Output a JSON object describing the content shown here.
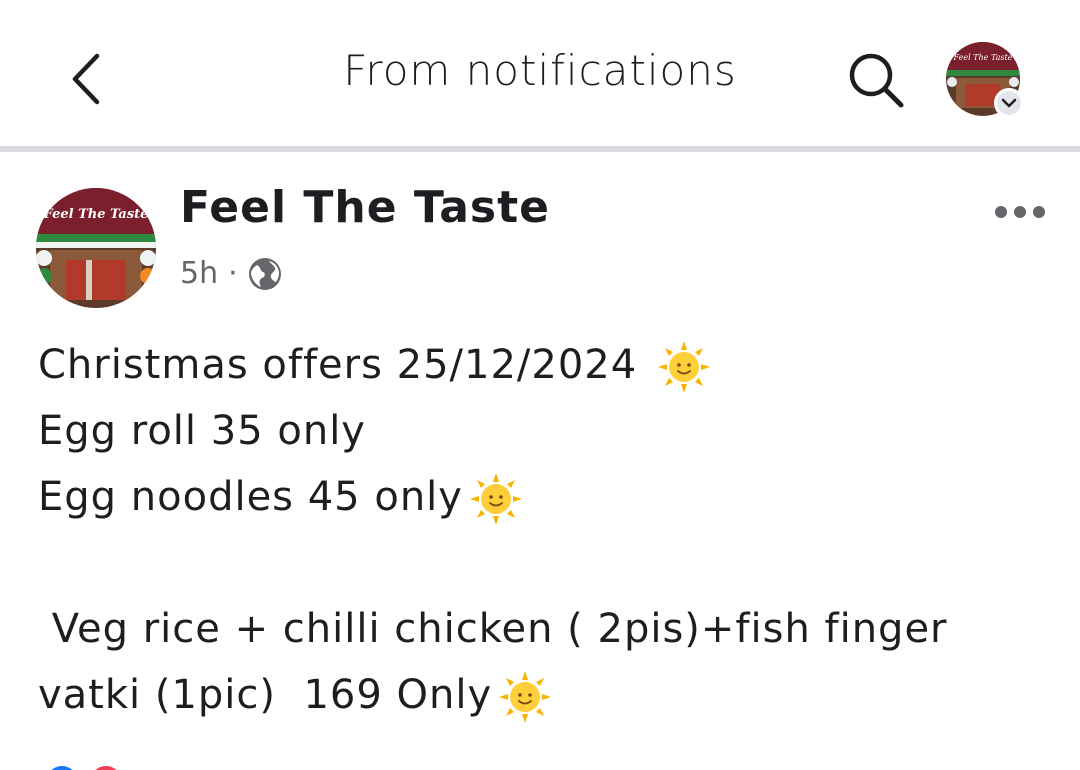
{
  "header": {
    "title": "From notifications",
    "back_icon": "chevron-left-icon",
    "search_icon": "search-icon",
    "profile_badge_icon": "chevron-down-icon"
  },
  "post": {
    "page_name": "Feel The Taste",
    "time": "5h",
    "separator": "·",
    "privacy_icon": "globe-icon",
    "menu_icon": "more-horizontal-icon",
    "avatar_text": "Feel The Taste",
    "body_lines": [
      "Christmas offers 25/12/2024",
      "Egg roll 35 only",
      "Egg noodles 45 only",
      "",
      " Veg rice + chilli chicken ( 2pis)+fish finger",
      "vatki (1pic)  169 Only"
    ],
    "emoji": "sun-with-face"
  },
  "colors": {
    "text": "#1c1e21",
    "secondary_text": "#65676b",
    "divider": "#d8dadf",
    "sun": "#f7b500"
  }
}
